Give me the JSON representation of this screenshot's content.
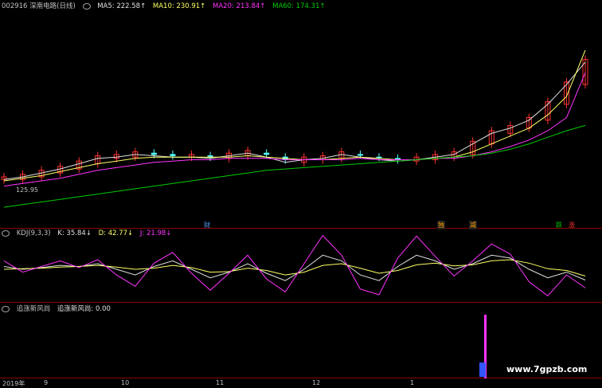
{
  "main_panel": {
    "stock_label": "002916 深南电路(日线)",
    "ma5": "MA5: 222.58↑",
    "ma10": "MA10: 230.91↑",
    "ma20": "MA20: 213.84↑",
    "ma60": "MA60: 174.31↑",
    "low_price_label": "125.95",
    "event_markers": [
      "财",
      "独",
      "减",
      "跌",
      "涨"
    ]
  },
  "kdj_panel": {
    "title": "KDJ(9,3,3)",
    "k": "K: 35.84↓",
    "d": "D: 42.77↓",
    "j": "J: 21.98↓"
  },
  "indicator_panel": {
    "title": "追涨新风尚",
    "value_label": "追涨新风尚: 0.00"
  },
  "x_axis": [
    "2019年",
    "9",
    "10",
    "11",
    "12",
    "1"
  ],
  "watermark": "www.7gpzb.com",
  "colors": {
    "background": "#000000",
    "up": "#ff3232",
    "down": "#54ffff",
    "ma5": "#e0e0e0",
    "ma10": "#ffff66",
    "ma20": "#ff33ff",
    "ma60": "#00cc00",
    "border": "#8b0000"
  },
  "chart_data": [
    {
      "type": "line",
      "title": "002916 深南电路(日线)",
      "note_series_from_legend": true,
      "series": [
        {
          "name": "MA5",
          "values": [
            133,
            135,
            138,
            141,
            145,
            149,
            150,
            152,
            151,
            150,
            150,
            149,
            151,
            153,
            150,
            146,
            148,
            149,
            152,
            150,
            148,
            147,
            148,
            150,
            152,
            160,
            168,
            172,
            178,
            190,
            205,
            222
          ]
        },
        {
          "name": "MA10",
          "values": [
            132,
            134,
            136,
            139,
            142,
            145,
            147,
            149,
            150,
            150,
            150,
            150,
            150,
            151,
            150,
            149,
            148,
            148,
            149,
            150,
            149,
            148,
            148,
            149,
            150,
            154,
            160,
            166,
            172,
            182,
            196,
            231
          ]
        },
        {
          "name": "MA20",
          "values": [
            128,
            130,
            132,
            134,
            137,
            140,
            142,
            144,
            146,
            147,
            148,
            148,
            149,
            149,
            149,
            148,
            148,
            148,
            148,
            149,
            148,
            148,
            148,
            149,
            149,
            151,
            154,
            158,
            163,
            170,
            180,
            214
          ]
        },
        {
          "name": "MA60",
          "values": [
            112,
            114,
            116,
            118,
            120,
            122,
            124,
            126,
            128,
            130,
            132,
            134,
            136,
            138,
            140,
            141,
            142,
            143,
            144,
            145,
            146,
            147,
            148,
            149,
            150,
            151,
            153,
            156,
            160,
            165,
            170,
            174
          ]
        }
      ]
    },
    {
      "type": "line",
      "title": "KDJ(9,3,3)",
      "series": [
        {
          "name": "K",
          "values": [
            60,
            55,
            58,
            62,
            60,
            65,
            55,
            45,
            60,
            70,
            55,
            40,
            50,
            65,
            48,
            35,
            55,
            80,
            70,
            45,
            35,
            60,
            80,
            70,
            55,
            65,
            80,
            75,
            55,
            40,
            50,
            36
          ]
        },
        {
          "name": "D",
          "values": [
            55,
            56,
            57,
            59,
            60,
            62,
            59,
            55,
            57,
            62,
            58,
            50,
            51,
            57,
            53,
            45,
            50,
            62,
            65,
            57,
            48,
            53,
            63,
            66,
            61,
            63,
            70,
            72,
            66,
            56,
            53,
            43
          ]
        },
        {
          "name": "J",
          "values": [
            70,
            50,
            60,
            70,
            58,
            72,
            45,
            25,
            66,
            85,
            48,
            18,
            48,
            80,
            38,
            15,
            65,
            115,
            80,
            20,
            10,
            75,
            114,
            78,
            43,
            70,
            100,
            82,
            33,
            8,
            45,
            22
          ]
        }
      ]
    },
    {
      "type": "bar",
      "title": "追涨新风尚",
      "values": [
        0.0
      ]
    }
  ]
}
